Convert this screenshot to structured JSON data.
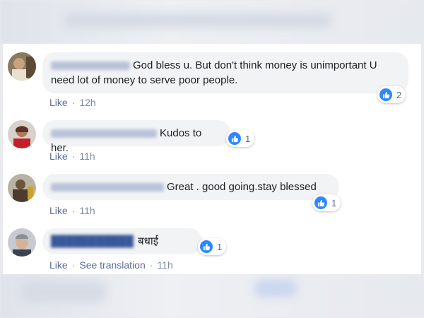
{
  "comments": [
    {
      "text": "God bless u. But don't think money is unimportant U need lot of money to serve poor people.",
      "like_label": "Like",
      "time": "12h",
      "reaction_count": "2"
    },
    {
      "text": "Kudos to her.",
      "like_label": "Like",
      "time": "11h",
      "reaction_count": "1"
    },
    {
      "text": "Great . good going.stay blessed",
      "like_label": "Like",
      "time": "11h",
      "reaction_count": "1"
    },
    {
      "text": "बधाई",
      "like_label": "Like",
      "translation_label": "See translation",
      "time": "11h",
      "reaction_count": "1"
    }
  ],
  "colors": {
    "bubble": "#f2f3f5",
    "link": "#5a6f94",
    "like_blue": "#2d88ff"
  }
}
